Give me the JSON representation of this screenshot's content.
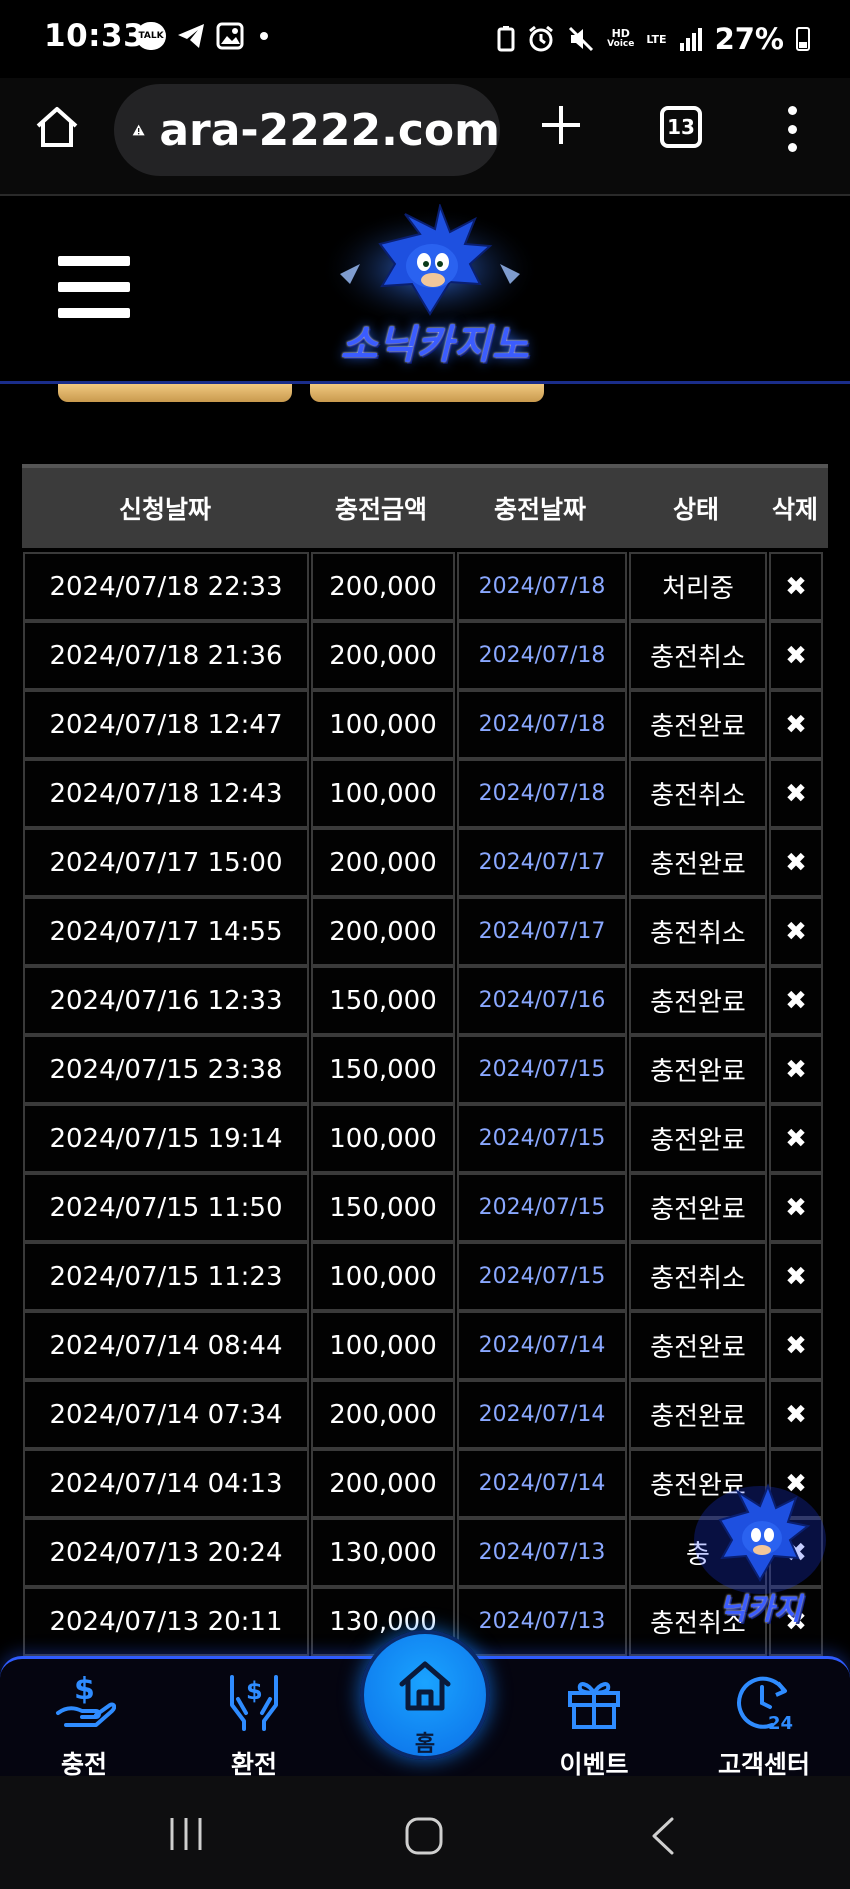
{
  "status_bar": {
    "time": "10:33",
    "talk_label": "TALK",
    "hd_label": "HD",
    "voice_label": "Voice",
    "lte_label": "LTE",
    "battery": "27%"
  },
  "browser": {
    "url": "ara-2222.com",
    "tab_count": "13"
  },
  "site": {
    "logo_text": "소닉카지노"
  },
  "table": {
    "headers": {
      "request_date": "신청날짜",
      "amount": "충전금액",
      "charge_date": "충전날짜",
      "status": "상태",
      "delete": "삭제"
    },
    "delete_symbol": "✖",
    "rows": [
      {
        "request_date": "2024/07/18 22:33",
        "amount": "200,000",
        "charge_date": "2024/07/18",
        "status": "처리중"
      },
      {
        "request_date": "2024/07/18 21:36",
        "amount": "200,000",
        "charge_date": "2024/07/18",
        "status": "충전취소"
      },
      {
        "request_date": "2024/07/18 12:47",
        "amount": "100,000",
        "charge_date": "2024/07/18",
        "status": "충전완료"
      },
      {
        "request_date": "2024/07/18 12:43",
        "amount": "100,000",
        "charge_date": "2024/07/18",
        "status": "충전취소"
      },
      {
        "request_date": "2024/07/17 15:00",
        "amount": "200,000",
        "charge_date": "2024/07/17",
        "status": "충전완료"
      },
      {
        "request_date": "2024/07/17 14:55",
        "amount": "200,000",
        "charge_date": "2024/07/17",
        "status": "충전취소"
      },
      {
        "request_date": "2024/07/16 12:33",
        "amount": "150,000",
        "charge_date": "2024/07/16",
        "status": "충전완료"
      },
      {
        "request_date": "2024/07/15 23:38",
        "amount": "150,000",
        "charge_date": "2024/07/15",
        "status": "충전완료"
      },
      {
        "request_date": "2024/07/15 19:14",
        "amount": "100,000",
        "charge_date": "2024/07/15",
        "status": "충전완료"
      },
      {
        "request_date": "2024/07/15 11:50",
        "amount": "150,000",
        "charge_date": "2024/07/15",
        "status": "충전완료"
      },
      {
        "request_date": "2024/07/15 11:23",
        "amount": "100,000",
        "charge_date": "2024/07/15",
        "status": "충전취소"
      },
      {
        "request_date": "2024/07/14 08:44",
        "amount": "100,000",
        "charge_date": "2024/07/14",
        "status": "충전완료"
      },
      {
        "request_date": "2024/07/14 07:34",
        "amount": "200,000",
        "charge_date": "2024/07/14",
        "status": "충전완료"
      },
      {
        "request_date": "2024/07/14 04:13",
        "amount": "200,000",
        "charge_date": "2024/07/14",
        "status": "충전완료"
      },
      {
        "request_date": "2024/07/13 20:24",
        "amount": "130,000",
        "charge_date": "2024/07/13",
        "status": "충"
      },
      {
        "request_date": "2024/07/13 20:11",
        "amount": "130,000",
        "charge_date": "2024/07/13",
        "status": "충전취소"
      }
    ]
  },
  "floating_badge": {
    "text": "닉카지"
  },
  "bottom_nav": {
    "charge": "충전",
    "exchange": "환전",
    "home": "홈",
    "event": "이벤트",
    "support": "고객센터",
    "support_icon_text": "24"
  },
  "colors": {
    "accent_blue": "#1aa3ff",
    "charge_date_text": "#8aa8ff",
    "header_bg": "#3b3b3b",
    "tab_gold": "#e0b46a"
  }
}
